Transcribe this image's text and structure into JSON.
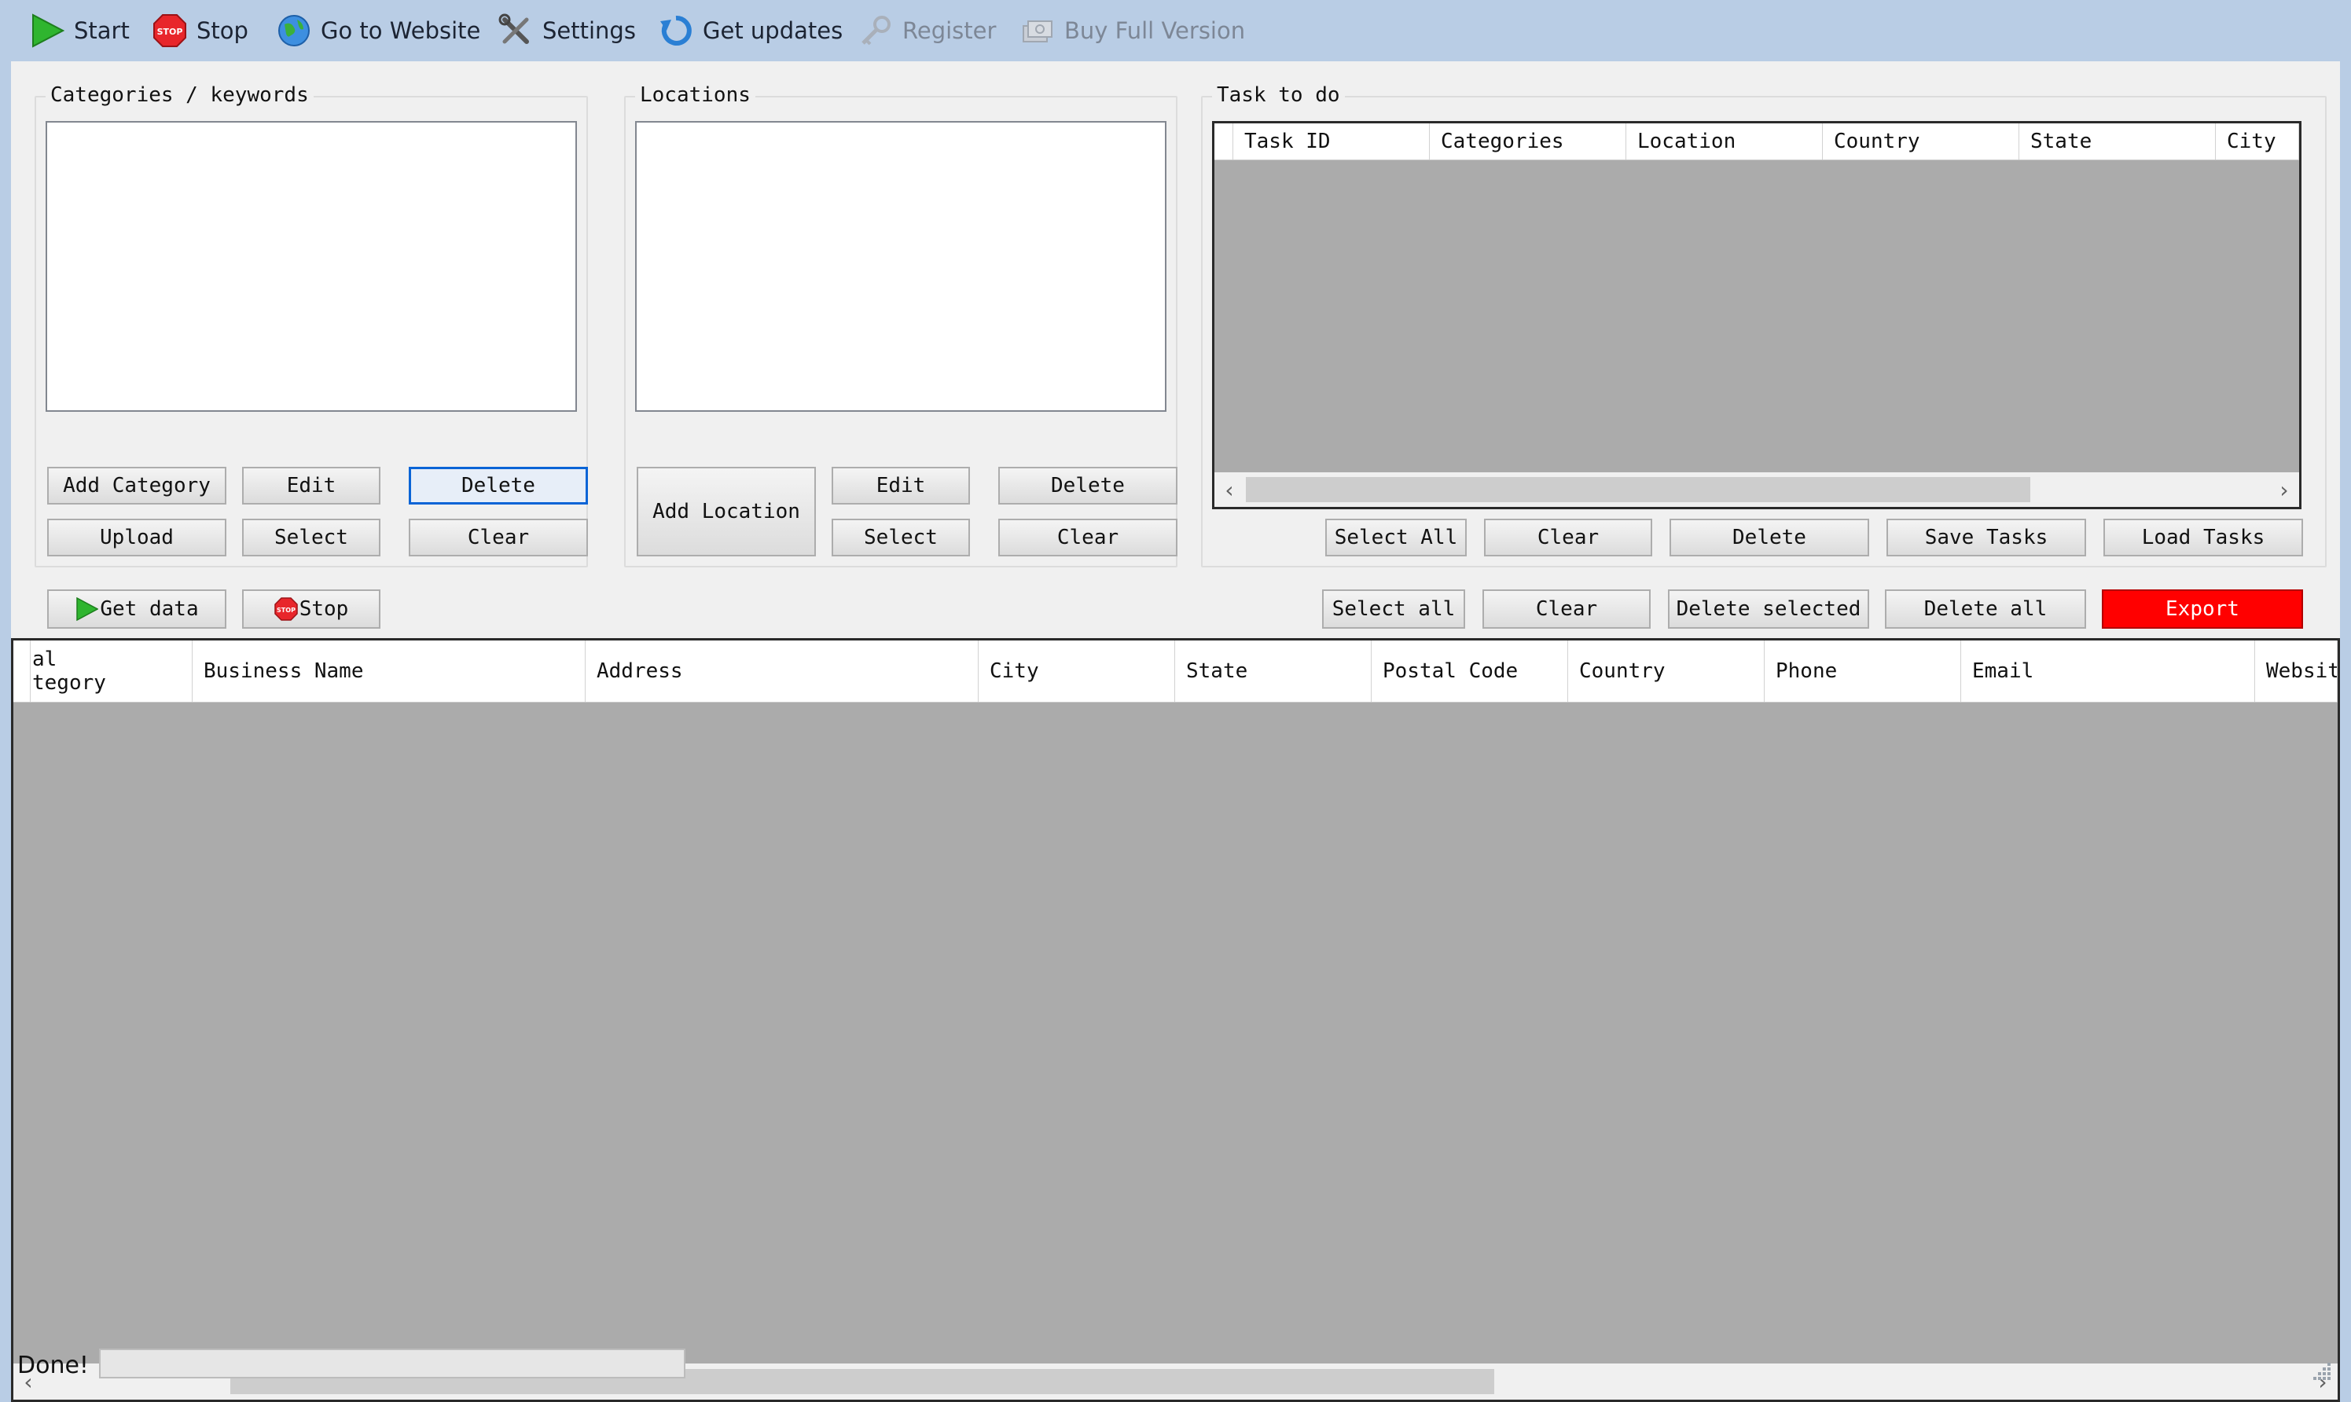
{
  "toolbar": {
    "start": "Start",
    "stop": "Stop",
    "website": "Go to Website",
    "settings": "Settings",
    "updates": "Get updates",
    "register": "Register",
    "buy": "Buy Full Version"
  },
  "categories": {
    "title": "Categories / keywords",
    "add": "Add Category",
    "edit": "Edit",
    "delete": "Delete",
    "upload": "Upload",
    "select": "Select",
    "clear": "Clear"
  },
  "locations": {
    "title": "Locations",
    "add": "Add Location",
    "edit": "Edit",
    "delete": "Delete",
    "select": "Select",
    "clear": "Clear"
  },
  "tasks": {
    "title": "Task to do",
    "columns": [
      "Task ID",
      "Categories",
      "Location",
      "Country",
      "State",
      "City"
    ],
    "select_all": "Select All",
    "clear": "Clear",
    "delete": "Delete",
    "save": "Save Tasks",
    "load": "Load Tasks"
  },
  "actions": {
    "get_data": "Get data",
    "stop": "Stop",
    "select_all": "Select all",
    "clear": "Clear",
    "delete_selected": "Delete selected",
    "delete_all": "Delete all",
    "export": "Export"
  },
  "results": {
    "first_column_line1": "al",
    "first_column_line2": "tegory",
    "columns": [
      "Business Name",
      "Address",
      "City",
      "State",
      "Postal Code",
      "Country",
      "Phone",
      "Email",
      "Websit"
    ]
  },
  "status": {
    "text": "Done!",
    "progress": 0
  },
  "colors": {
    "accent": "#0a64d6",
    "export": "#ff0000",
    "grid_bg": "#ababab",
    "toolbar_bg": "#b9cde5"
  }
}
